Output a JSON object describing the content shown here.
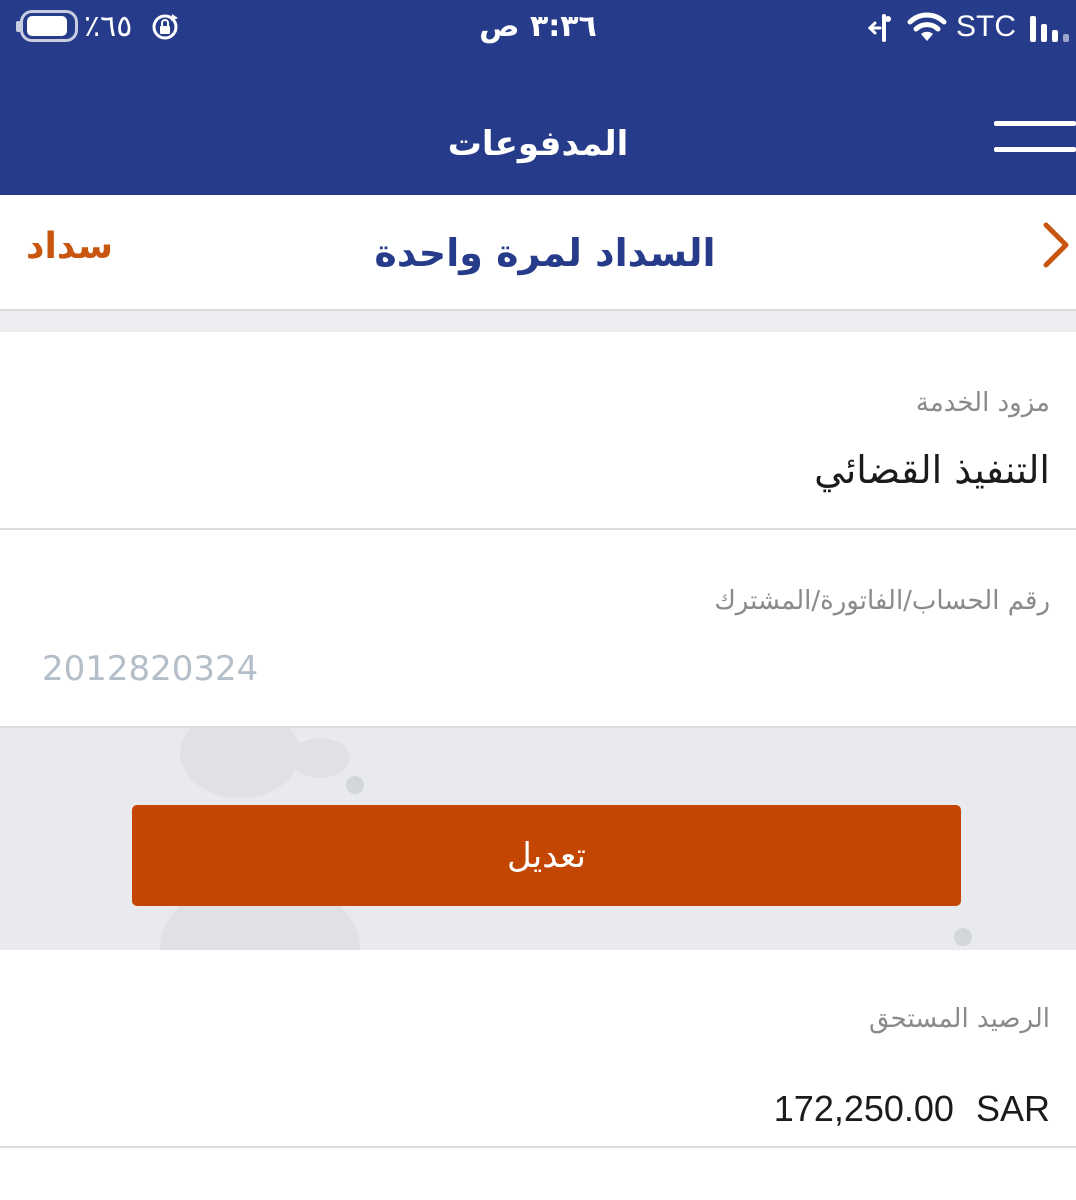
{
  "status_bar": {
    "battery_percent": "٪٦٥",
    "time": "٣:٣٦ ص",
    "carrier": "STC"
  },
  "header": {
    "title": "المدفوعات"
  },
  "subbar": {
    "brand": "سداد",
    "title": "السداد لمرة واحدة"
  },
  "service_provider": {
    "label": "مزود الخدمة",
    "value": "التنفيذ القضائي"
  },
  "account_number": {
    "label": "رقم الحساب/الفاتورة/المشترك",
    "placeholder": "2012820324"
  },
  "edit_button": {
    "label": "تعديل"
  },
  "balance": {
    "label": "الرصيد المستحق",
    "amount": "172,250.00",
    "currency": "SAR"
  },
  "icons": {
    "battery": "battery-icon",
    "rotation_lock": "rotation-lock-icon",
    "call": "call-forward-icon",
    "wifi": "wifi-icon",
    "signal": "signal-icon",
    "menu": "hamburger-menu-icon",
    "back": "chevron-right-icon"
  },
  "colors": {
    "primary_navy": "#263b8a",
    "accent_orange": "#c44603",
    "brand_orange": "#c9560f"
  }
}
